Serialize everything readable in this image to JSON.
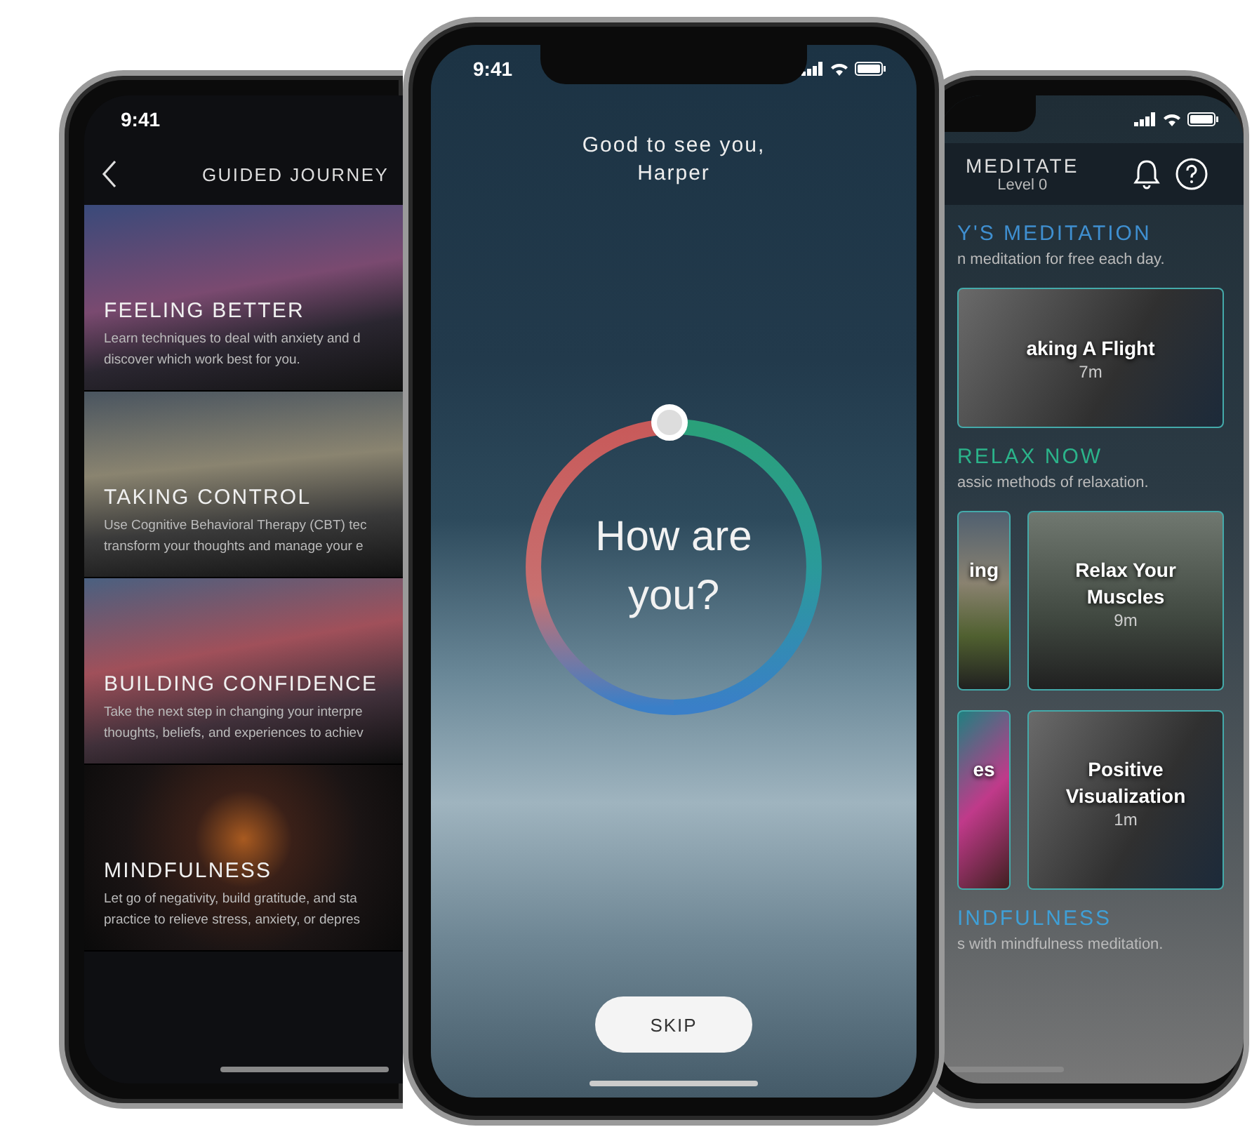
{
  "left_phone": {
    "status_time": "9:41",
    "header": {
      "title": "GUIDED JOURNEY"
    },
    "journeys": [
      {
        "title": "FEELING BETTER",
        "description": [
          "Learn techniques to deal with anxiety and d",
          "discover which work best for you."
        ]
      },
      {
        "title": "TAKING CONTROL",
        "description": [
          "Use Cognitive Behavioral Therapy (CBT) tec",
          "transform your thoughts and manage your e"
        ]
      },
      {
        "title": "BUILDING CONFIDENCE",
        "description": [
          "Take the next step in changing your interpre",
          "thoughts, beliefs, and experiences to achiev"
        ]
      },
      {
        "title": "MINDFULNESS",
        "description": [
          "Let go of negativity, build gratitude, and sta",
          "practice to relieve stress, anxiety, or depres"
        ]
      }
    ]
  },
  "center_phone": {
    "status_time": "9:41",
    "greeting": [
      "Good to see you,",
      "Harper"
    ],
    "prompt": "How are you?",
    "skip_button": "SKIP"
  },
  "right_phone": {
    "header": {
      "title": "MEDITATE",
      "subtitle": "Level 0"
    },
    "sections": [
      {
        "title": "Y'S MEDITATION",
        "color": "#3f8fd0",
        "subtitle": "n meditation for free each day.",
        "cards": [
          {
            "kind": "wide",
            "title": "aking A Flight",
            "duration": "7m"
          }
        ]
      },
      {
        "title": "RELAX NOW",
        "color": "#2bb38a",
        "subtitle": "assic methods of relaxation.",
        "cards": [
          {
            "kind": "tile",
            "title": "ing"
          },
          {
            "kind": "tile",
            "title": "Relax Your Muscles",
            "duration": "9m"
          },
          {
            "kind": "tile",
            "title": "es"
          },
          {
            "kind": "tile",
            "title": "Positive Visualization",
            "duration": "1m"
          }
        ]
      },
      {
        "title": "INDFULNESS",
        "color": "#3f9fd6",
        "subtitle": "s with mindfulness meditation."
      }
    ]
  }
}
